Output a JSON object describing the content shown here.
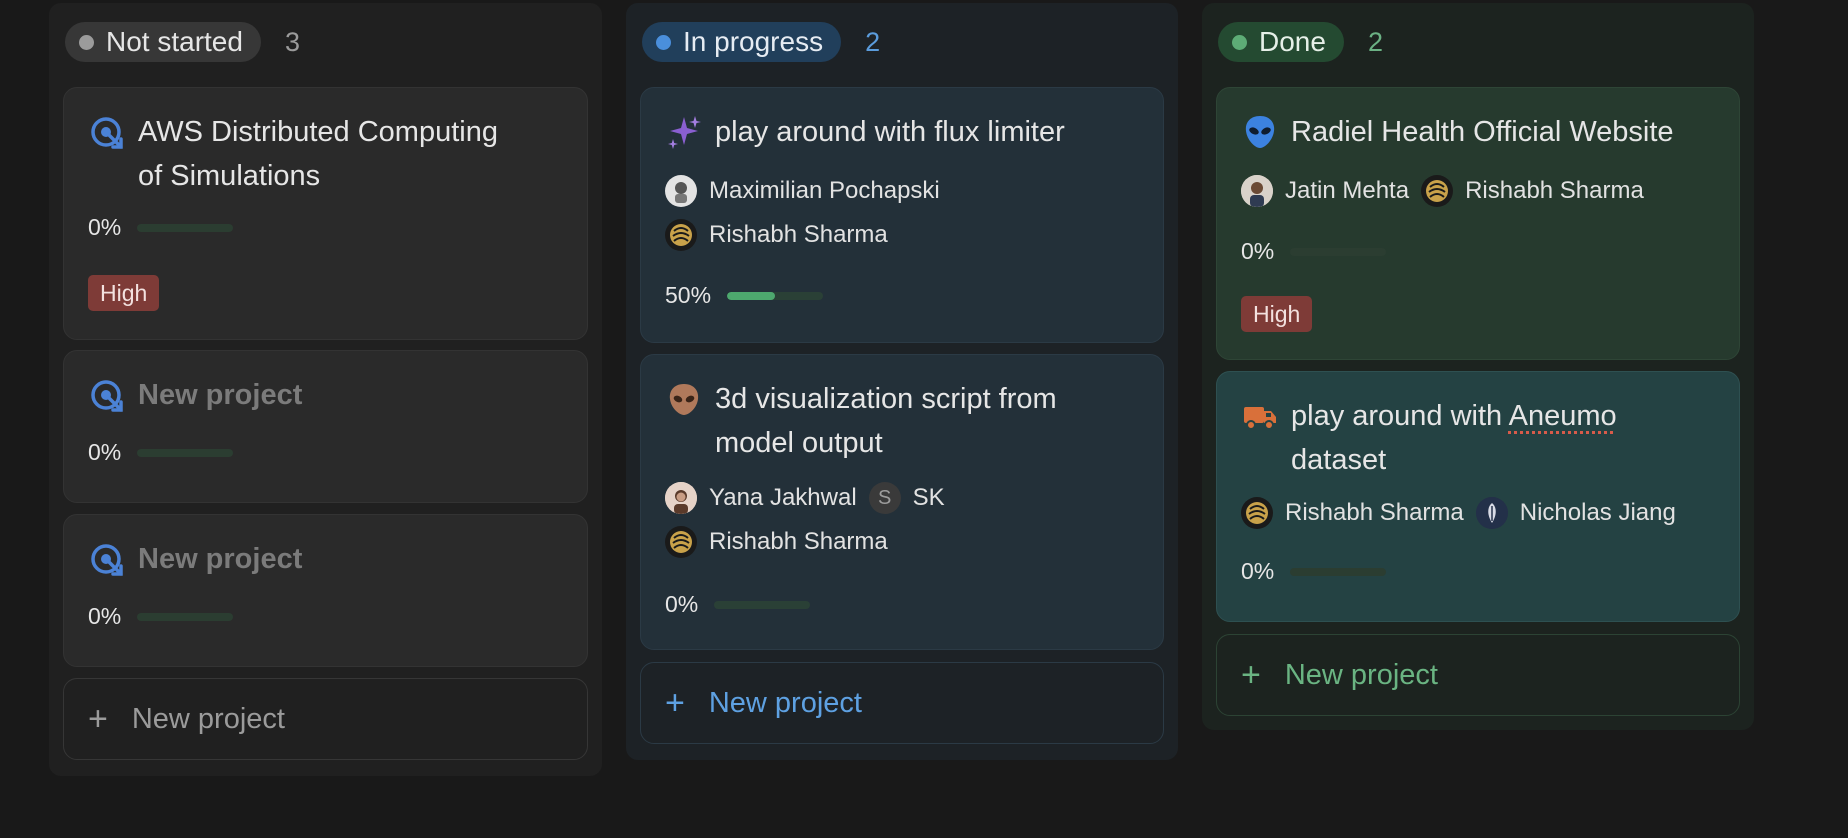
{
  "columns": {
    "not_started": {
      "label": "Not started",
      "count": "3",
      "cards": [
        {
          "title_line1": "AWS Distributed Computing",
          "title_line2": "of Simulations",
          "progress_text": "0%",
          "progress": 0,
          "tag": "High"
        },
        {
          "title": "New project",
          "progress_text": "0%",
          "progress": 0
        },
        {
          "title": "New project",
          "progress_text": "0%",
          "progress": 0
        }
      ],
      "new_label": "New project"
    },
    "in_progress": {
      "label": "In progress",
      "count": "2",
      "cards": [
        {
          "title": "play around with flux limiter",
          "people": [
            "Maximilian Pochapski",
            "Rishabh Sharma"
          ],
          "progress_text": "50%",
          "progress": 0.5
        },
        {
          "title_line1": "3d visualization script from",
          "title_line2": "model output",
          "people": [
            "Yana Jakhwal",
            "SK",
            "Rishabh Sharma"
          ],
          "initial": "S",
          "progress_text": "0%",
          "progress": 0
        }
      ],
      "new_label": "New project"
    },
    "done": {
      "label": "Done",
      "count": "2",
      "cards": [
        {
          "title": "Radiel Health Official Website",
          "people": [
            "Jatin Mehta",
            "Rishabh Sharma"
          ],
          "progress_text": "0%",
          "progress": 0,
          "tag": "High"
        },
        {
          "title_prefix": "play around with ",
          "title_underlined": "Aneumo",
          "title_line2": "dataset",
          "people": [
            "Rishabh Sharma",
            "Nicholas Jiang"
          ],
          "progress_text": "0%",
          "progress": 0
        }
      ],
      "new_label": "New project"
    }
  },
  "colors": {
    "background": "#191919",
    "tag_high": "#7e3b37",
    "progress_fill": "#4da86e",
    "in_progress_accent": "#5ea1e2",
    "done_accent": "#6ab482"
  },
  "icons": {
    "not_started_card": "target-arrow-icon",
    "flux": "sparkles-icon",
    "visualization": "alien-face-icon",
    "radiel": "alien-icon",
    "aneumo": "truck-icon"
  }
}
